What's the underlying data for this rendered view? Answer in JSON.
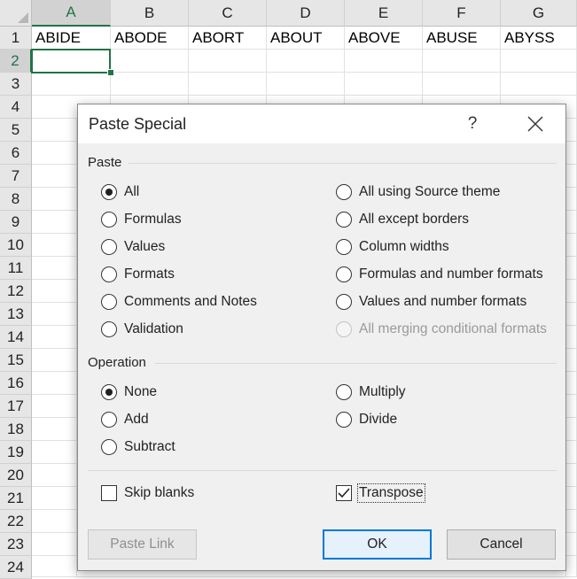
{
  "sheet": {
    "columns": [
      "A",
      "B",
      "C",
      "D",
      "E",
      "F",
      "G"
    ],
    "rows": [
      "1",
      "2",
      "3",
      "4",
      "5",
      "6",
      "7",
      "8",
      "9",
      "10",
      "11",
      "12",
      "13",
      "14",
      "15",
      "16",
      "17",
      "18",
      "19",
      "20",
      "21",
      "22",
      "23",
      "24"
    ],
    "row1_values": [
      "ABIDE",
      "ABODE",
      "ABORT",
      "ABOUT",
      "ABOVE",
      "ABUSE",
      "ABYSS"
    ],
    "selected_column": "A",
    "selected_row": "2",
    "accent_color": "#217346"
  },
  "dialog": {
    "title": "Paste Special",
    "help_label": "?",
    "paste_section": "Paste",
    "paste_options_left": [
      {
        "label": "All",
        "selected": true,
        "disabled": false
      },
      {
        "label": "Formulas",
        "selected": false,
        "disabled": false
      },
      {
        "label": "Values",
        "selected": false,
        "disabled": false
      },
      {
        "label": "Formats",
        "selected": false,
        "disabled": false
      },
      {
        "label": "Comments and Notes",
        "selected": false,
        "disabled": false
      },
      {
        "label": "Validation",
        "selected": false,
        "disabled": false
      }
    ],
    "paste_options_right": [
      {
        "label": "All using Source theme",
        "selected": false,
        "disabled": false
      },
      {
        "label": "All except borders",
        "selected": false,
        "disabled": false
      },
      {
        "label": "Column widths",
        "selected": false,
        "disabled": false
      },
      {
        "label": "Formulas and number formats",
        "selected": false,
        "disabled": false
      },
      {
        "label": "Values and number formats",
        "selected": false,
        "disabled": false
      },
      {
        "label": "All merging conditional formats",
        "selected": false,
        "disabled": true
      }
    ],
    "operation_section": "Operation",
    "operation_options_left": [
      {
        "label": "None",
        "selected": true
      },
      {
        "label": "Add",
        "selected": false
      },
      {
        "label": "Subtract",
        "selected": false
      }
    ],
    "operation_options_right": [
      {
        "label": "Multiply",
        "selected": false
      },
      {
        "label": "Divide",
        "selected": false
      }
    ],
    "skip_blanks": {
      "label": "Skip blanks",
      "checked": false
    },
    "transpose": {
      "label": "Transpose",
      "checked": true
    },
    "buttons": {
      "paste_link": "Paste Link",
      "ok": "OK",
      "cancel": "Cancel"
    },
    "default_button_color": "#0078d7"
  }
}
